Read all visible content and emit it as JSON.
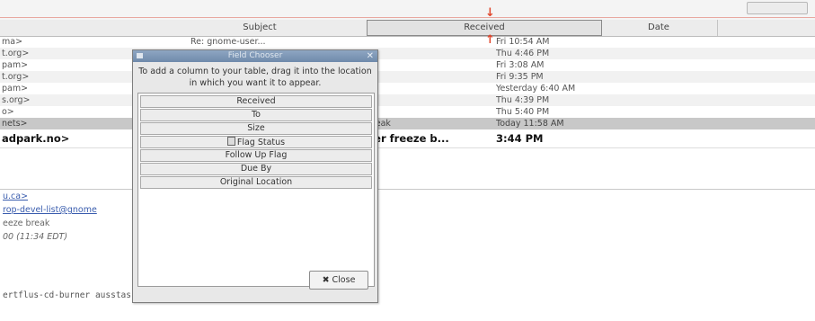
{
  "columns": {
    "subject": "Subject",
    "received": "Received",
    "date": "Date"
  },
  "rows": [
    {
      "from": "ma>",
      "subject": "Re: gnome-user...",
      "subject2": "",
      "date": "Fri 10:54 AM"
    },
    {
      "from": "t.org>",
      "subject": "",
      "subject2": "",
      "date": "Thu 4:46 PM"
    },
    {
      "from": "pam>",
      "subject": "",
      "subject2": "",
      "date": "Fri 3:08 AM"
    },
    {
      "from": "t.org>",
      "subject": "",
      "subject2": "",
      "date": "Fri 9:35 PM"
    },
    {
      "from": "pam>",
      "subject": "",
      "subject2": "",
      "date": "Yesterday 6:40 AM"
    },
    {
      "from": "s.org>",
      "subject": "",
      "subject2": "",
      "date": "Thu 4:39 PM"
    },
    {
      "from": "o>",
      "subject": "",
      "subject2": "",
      "date": "Thu 5:40 PM"
    },
    {
      "from": "nets>",
      "subject": "",
      "subject2": "break",
      "date": "Today 11:58 AM"
    },
    {
      "from": "adpark.no>",
      "subject": "",
      "subject2": "ner freeze b...",
      "date": "3:44 PM"
    }
  ],
  "preview": {
    "line1": "u.ca>",
    "line2": "rop-devel-list@gnome",
    "line3": "eeze break",
    "line4": "00 (11:34 EDT)",
    "body": "ertflus-cd-burner ausstasse..."
  },
  "dialog": {
    "title": "Field Chooser",
    "message": "To add a column to your table, drag it into the location in which you want it to appear.",
    "items": [
      "Received",
      "To",
      "Size",
      "Flag Status",
      "Follow Up Flag",
      "Due By",
      "Original Location"
    ],
    "close_label": "Close"
  }
}
